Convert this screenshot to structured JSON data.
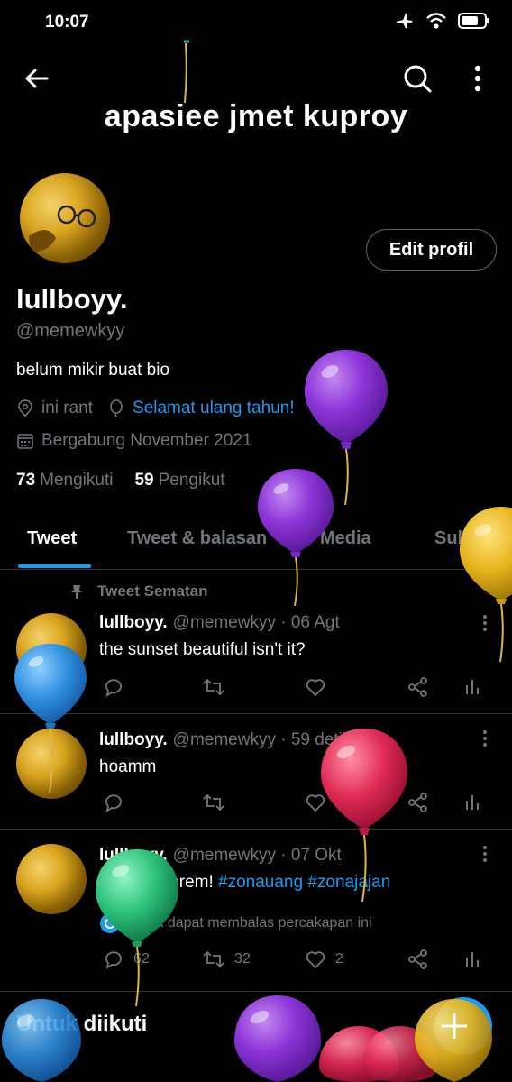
{
  "status": {
    "time": "10:07"
  },
  "header": {
    "title": "apasiee jmet kuproy"
  },
  "profile": {
    "edit_label": "Edit profil",
    "name": "lullboyy.",
    "handle": "@memewkyy",
    "bio": "belum mikir buat bio",
    "location": "ini rant",
    "birthday": "Selamat ulang tahun!",
    "joined": "Bergabung November 2021",
    "following_count": "73",
    "following_label": "Mengikuti",
    "followers_count": "59",
    "followers_label": "Pengikut"
  },
  "tabs": [
    "Tweet",
    "Tweet & balasan",
    "Media",
    "Suka"
  ],
  "pinned_label": "Tweet Sematan",
  "tweets": [
    {
      "name": "lullboyy.",
      "meta": "@memewkyy · 06 Agt",
      "text": "the sunset beautiful isn't it?",
      "replies": "",
      "retweets": "",
      "likes": ""
    },
    {
      "name": "lullboyy.",
      "meta": "@memewkyy · 59 detik",
      "text": "hoamm",
      "replies": "",
      "retweets": "",
      "likes": ""
    },
    {
      "name": "lullboyy.",
      "meta": "@memewkyy · 07 Okt",
      "text_plain": "need spoprem! ",
      "tag1": "#zonauang",
      "tag2": "#zonajajan",
      "reply_note": "Anda dapat membalas percakapan ini",
      "replies": "62",
      "retweets": "32",
      "likes": "2"
    }
  ],
  "bottom": {
    "label": "Untuk diikuti"
  },
  "colors": {
    "background": "#000000",
    "accent": "#1d9bf0",
    "muted": "#71767b",
    "divider": "#2f3336"
  },
  "icons": [
    "back-arrow-icon",
    "search-icon",
    "more-vertical-icon",
    "location-icon",
    "balloon-icon",
    "calendar-icon",
    "pin-icon",
    "reply-icon",
    "retweet-icon",
    "like-icon",
    "share-icon",
    "analytics-icon",
    "plus-icon"
  ]
}
